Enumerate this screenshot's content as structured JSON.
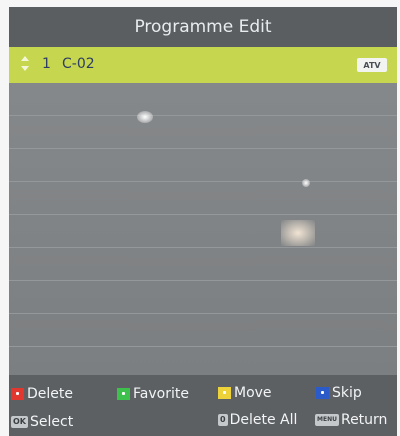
{
  "header": {
    "title": "Programme Edit"
  },
  "selected_channel": {
    "number": "1",
    "name": "C-02",
    "type_badge": "ATV"
  },
  "legend": {
    "delete": "Delete",
    "favorite": "Favorite",
    "move": "Move",
    "skip": "Skip",
    "ok_key": "OK",
    "select": "Select",
    "zero_key": "0",
    "delete_all": "Delete All",
    "menu_key": "MENU",
    "return": "Return"
  },
  "colors": {
    "red_key": "#e1372f",
    "green_key": "#3ec14c",
    "yellow_key": "#eed23a",
    "blue_key": "#2b5bc9",
    "selection_bar": "#c6d64f"
  }
}
